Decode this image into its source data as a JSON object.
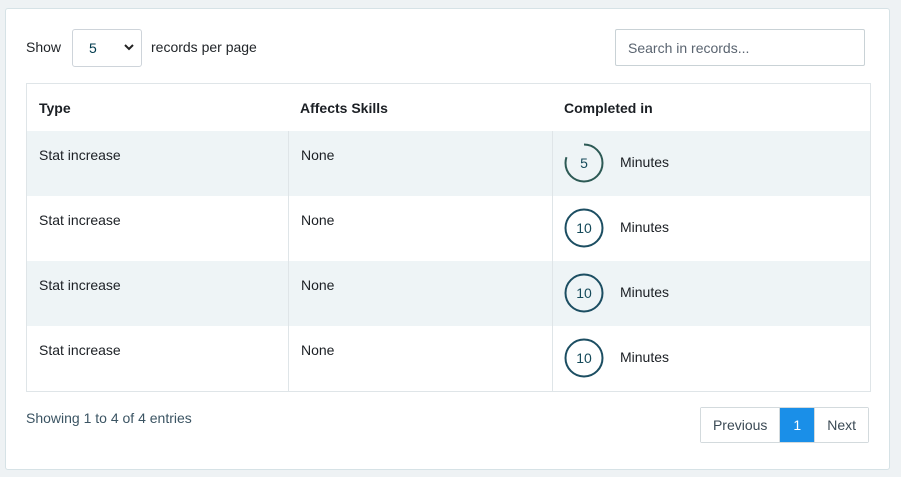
{
  "controls": {
    "show_label": "Show",
    "page_size_value": "5",
    "per_page_label": "records per page",
    "search_placeholder": "Search in records..."
  },
  "table": {
    "columns": [
      "Type",
      "Affects Skills",
      "Completed in"
    ],
    "rows": [
      {
        "type": "Stat increase",
        "affects": "None",
        "minutes": "5",
        "unit": "Minutes",
        "progress": 0.8
      },
      {
        "type": "Stat increase",
        "affects": "None",
        "minutes": "10",
        "unit": "Minutes",
        "progress": 1.0
      },
      {
        "type": "Stat increase",
        "affects": "None",
        "minutes": "10",
        "unit": "Minutes",
        "progress": 1.0
      },
      {
        "type": "Stat increase",
        "affects": "None",
        "minutes": "10",
        "unit": "Minutes",
        "progress": 1.0
      }
    ]
  },
  "footer": {
    "info": "Showing 1 to 4 of 4 entries",
    "previous_label": "Previous",
    "current_page": "1",
    "next_label": "Next"
  },
  "colors": {
    "ring_full": "#1c4e62",
    "ring_partial": "#2d5a55",
    "accent": "#1a8fe8"
  }
}
